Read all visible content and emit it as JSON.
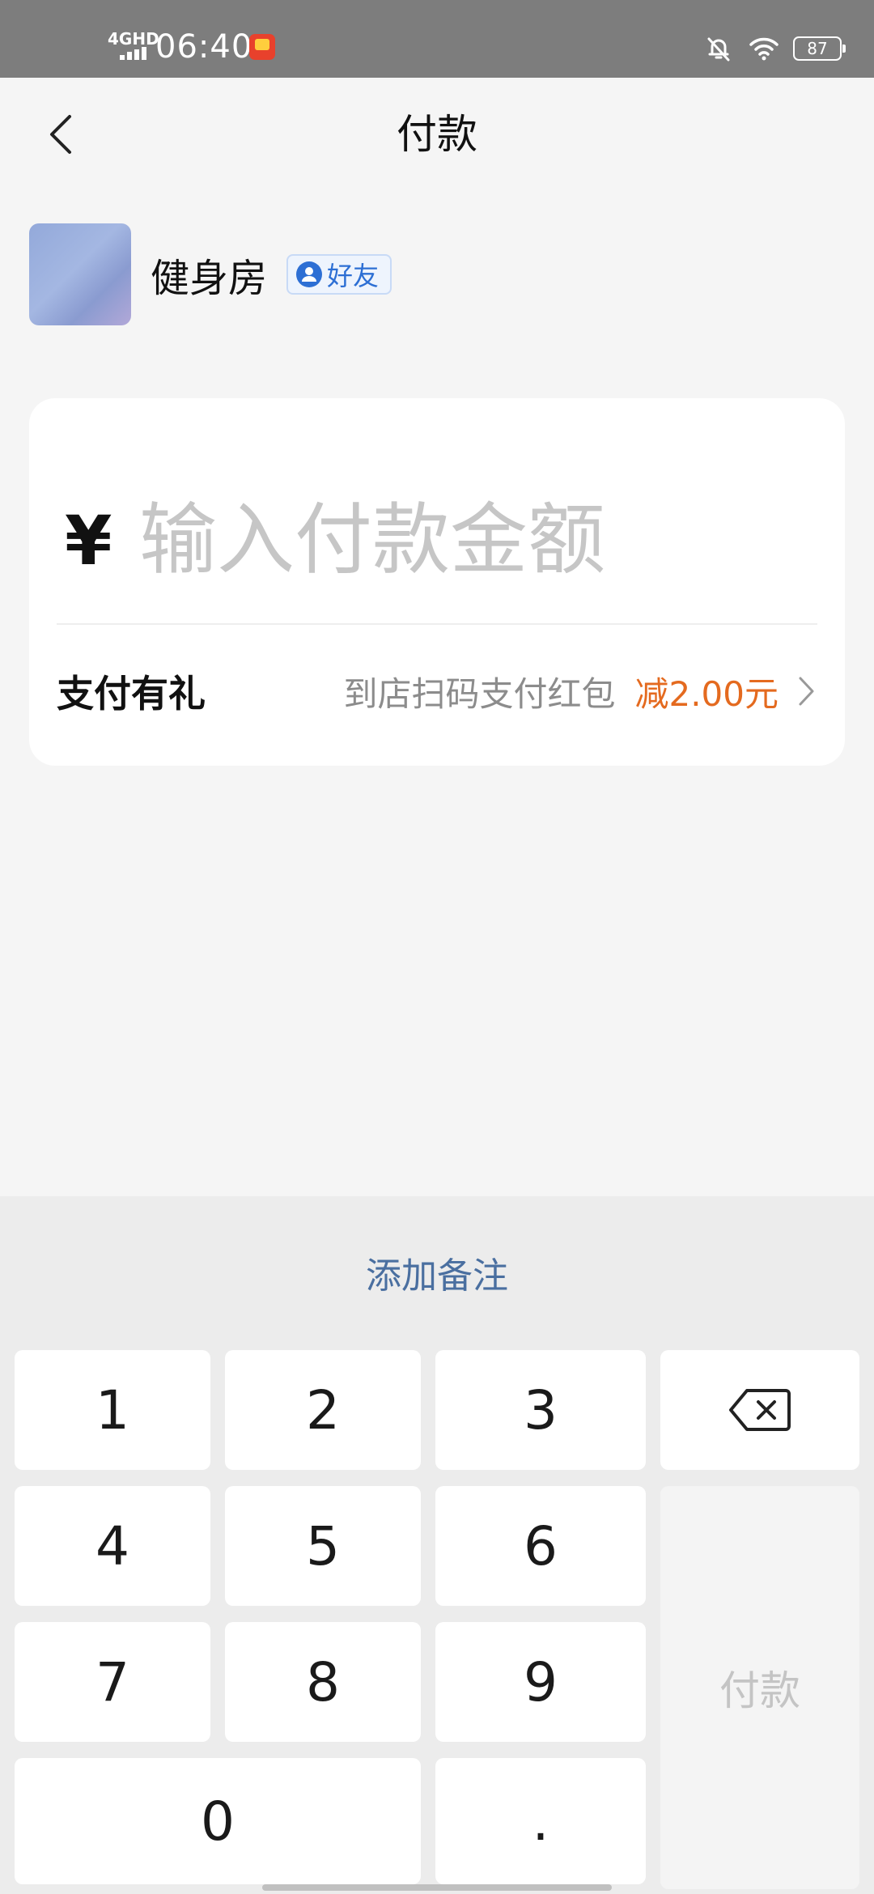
{
  "status_bar": {
    "network": "4GHD",
    "time": "06:40",
    "battery": "87"
  },
  "header": {
    "title": "付款"
  },
  "merchant": {
    "name": "健身房",
    "badge": "好友"
  },
  "amount": {
    "currency_symbol": "¥",
    "placeholder": "输入付款金额",
    "value": ""
  },
  "promo": {
    "title": "支付有礼",
    "description": "到店扫码支付红包",
    "discount": "减2.00元"
  },
  "keypad": {
    "remark_label": "添加备注",
    "keys": [
      "1",
      "2",
      "3",
      "4",
      "5",
      "6",
      "7",
      "8",
      "9",
      "0",
      "."
    ],
    "pay_label": "付款"
  },
  "colors": {
    "accent_blue": "#2d6fd4",
    "discount_orange": "#e46a1f",
    "remark_blue": "#4a6fa0"
  }
}
